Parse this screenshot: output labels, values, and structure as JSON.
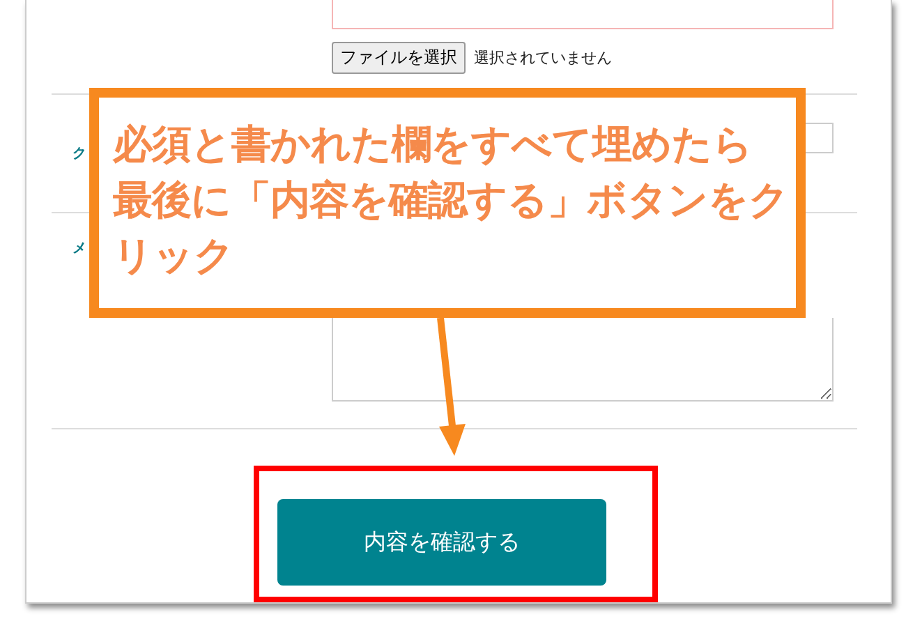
{
  "file_input": {
    "button": "ファイルを選択",
    "status": "選択されていません"
  },
  "coupon": {
    "label": "ク"
  },
  "memo": {
    "label": "メ"
  },
  "submit_button": "内容を確認する",
  "callout": {
    "lines": [
      "必須と書かれた欄をすべて埋めたら",
      "最後に「内容を確認する」ボタンをクリック"
    ]
  }
}
